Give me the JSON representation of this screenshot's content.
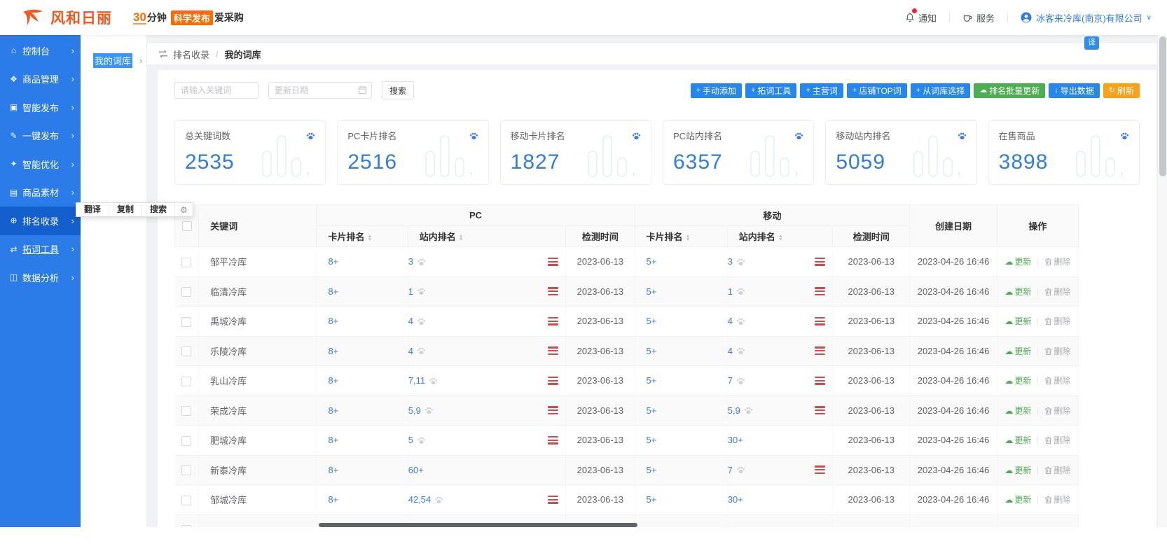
{
  "topbar": {
    "brand": "风和日丽",
    "tagline": {
      "num": "30",
      "unit": "分钟",
      "badge": "科学发布",
      "suffix": "爱采购"
    },
    "notify_label": "通知",
    "service_label": "服务",
    "account_label": "冰客来冷库(南京)有限公司"
  },
  "sidebar": {
    "items": [
      {
        "key": "dashboard",
        "icon": "home",
        "label": "控制台"
      },
      {
        "key": "product-management",
        "icon": "box",
        "label": "商品管理"
      },
      {
        "key": "smart-publish",
        "icon": "monitor",
        "label": "智能发布"
      },
      {
        "key": "one-click-publish",
        "icon": "pen",
        "label": "一键发布"
      },
      {
        "key": "smart-optimize",
        "icon": "magic",
        "label": "智能优化"
      },
      {
        "key": "product-materials",
        "icon": "image",
        "label": "商品素材"
      },
      {
        "key": "rank-index",
        "icon": "globe",
        "label": "排名收录",
        "active": true
      },
      {
        "key": "word-expand-tools",
        "icon": "code",
        "label": "拓词工具",
        "underline": true
      },
      {
        "key": "data-analytics",
        "icon": "chart",
        "label": "数据分析"
      }
    ]
  },
  "subsidebar": {
    "selected_item": "我的词库"
  },
  "selection_menu": {
    "items": [
      {
        "key": "translate",
        "label": "翻译"
      },
      {
        "key": "copy",
        "label": "复制"
      },
      {
        "key": "search",
        "label": "搜索"
      }
    ]
  },
  "breadcrumb": {
    "parent": "排名收录",
    "current": "我的词库"
  },
  "toolbar": {
    "keyword_placeholder": "请输入关键词",
    "date_placeholder": "更新日期",
    "search_label": "搜索",
    "buttons": [
      {
        "key": "manual-add",
        "icon": "plus",
        "style": "blue",
        "label": "手动添加"
      },
      {
        "key": "word-expand-tools",
        "icon": "plus",
        "style": "blue",
        "label": "拓词工具"
      },
      {
        "key": "main-words",
        "icon": "plus",
        "style": "blue",
        "label": "主营词"
      },
      {
        "key": "shop-top-words",
        "icon": "plus",
        "style": "blue",
        "label": "店铺TOP词"
      },
      {
        "key": "select-from-lexicon",
        "icon": "plus",
        "style": "blue",
        "label": "从词库选择"
      },
      {
        "key": "batch-update-rank",
        "icon": "cloud",
        "style": "green",
        "label": "排名批量更新"
      },
      {
        "key": "export-data",
        "icon": "download",
        "style": "blue",
        "label": "导出数据"
      },
      {
        "key": "refresh",
        "icon": "refresh",
        "style": "orange",
        "label": "刷新"
      }
    ]
  },
  "stats": [
    {
      "key": "total-keywords",
      "title": "总关键词数",
      "value": "2535"
    },
    {
      "key": "pc-card-rank",
      "title": "PC卡片排名",
      "value": "2516"
    },
    {
      "key": "mobile-card-rank",
      "title": "移动卡片排名",
      "value": "1827"
    },
    {
      "key": "pc-site-rank",
      "title": "PC站内排名",
      "value": "6357"
    },
    {
      "key": "mobile-site-rank",
      "title": "移动站内排名",
      "value": "5059"
    },
    {
      "key": "on-sale-products",
      "title": "在售商品",
      "value": "3898"
    }
  ],
  "table": {
    "headers": {
      "keyword": "关键词",
      "pc_group": "PC",
      "mobile_group": "移动",
      "card_rank": "卡片排名",
      "site_rank": "站内排名",
      "check_time": "检测时间",
      "created": "创建日期",
      "actions": "操作"
    },
    "action_labels": {
      "update": "更新",
      "delete": "删除"
    },
    "rows": [
      {
        "keyword": "邹平冷库",
        "pc_card": "8+",
        "pc_site": "3",
        "pc_paw": true,
        "pc_menu": true,
        "pc_time": "2023-06-13",
        "m_card": "5+",
        "m_site": "3",
        "m_paw": true,
        "m_menu": true,
        "m_time": "2023-06-13",
        "created": "2023-04-26 16:46"
      },
      {
        "keyword": "临清冷库",
        "pc_card": "8+",
        "pc_site": "1",
        "pc_paw": true,
        "pc_menu": true,
        "pc_time": "2023-06-13",
        "m_card": "5+",
        "m_site": "1",
        "m_paw": true,
        "m_menu": true,
        "m_time": "2023-06-13",
        "created": "2023-04-26 16:46"
      },
      {
        "keyword": "禹城冷库",
        "pc_card": "8+",
        "pc_site": "4",
        "pc_paw": true,
        "pc_menu": true,
        "pc_time": "2023-06-13",
        "m_card": "5+",
        "m_site": "4",
        "m_paw": true,
        "m_menu": true,
        "m_time": "2023-06-13",
        "created": "2023-04-26 16:46"
      },
      {
        "keyword": "乐陵冷库",
        "pc_card": "8+",
        "pc_site": "4",
        "pc_paw": true,
        "pc_menu": true,
        "pc_time": "2023-06-13",
        "m_card": "5+",
        "m_site": "4",
        "m_paw": true,
        "m_menu": true,
        "m_time": "2023-06-13",
        "created": "2023-04-26 16:46"
      },
      {
        "keyword": "乳山冷库",
        "pc_card": "8+",
        "pc_site": "7,11",
        "pc_paw": true,
        "pc_menu": true,
        "pc_time": "2023-06-13",
        "m_card": "5+",
        "m_site": "7",
        "m_paw": true,
        "m_menu": true,
        "m_time": "2023-06-13",
        "created": "2023-04-26 16:46"
      },
      {
        "keyword": "荣成冷库",
        "pc_card": "8+",
        "pc_site": "5,9",
        "pc_paw": true,
        "pc_menu": true,
        "pc_time": "2023-06-13",
        "m_card": "5+",
        "m_site": "5,9",
        "m_paw": true,
        "m_menu": true,
        "m_time": "2023-06-13",
        "created": "2023-04-26 16:46"
      },
      {
        "keyword": "肥城冷库",
        "pc_card": "8+",
        "pc_site": "5",
        "pc_paw": true,
        "pc_menu": true,
        "pc_time": "2023-06-13",
        "m_card": "5+",
        "m_site": "30+",
        "m_paw": false,
        "m_menu": false,
        "m_time": "2023-06-13",
        "created": "2023-04-26 16:46"
      },
      {
        "keyword": "新泰冷库",
        "pc_card": "8+",
        "pc_site": "60+",
        "pc_paw": false,
        "pc_menu": false,
        "pc_time": "2023-06-13",
        "m_card": "5+",
        "m_site": "7",
        "m_paw": true,
        "m_menu": true,
        "m_time": "2023-06-13",
        "created": "2023-04-26 16:46"
      },
      {
        "keyword": "邹城冷库",
        "pc_card": "8+",
        "pc_site": "42,54",
        "pc_paw": true,
        "pc_menu": true,
        "pc_time": "2023-06-13",
        "m_card": "5+",
        "m_site": "30+",
        "m_paw": false,
        "m_menu": false,
        "m_time": "2023-06-13",
        "created": "2023-04-26 16:46"
      }
    ]
  },
  "float_icon_glyph": "译",
  "colors": {
    "sidebar_blue": "#2b7ce9",
    "sidebar_active_blue": "#145fce",
    "primary_blue": "#2586ee",
    "link_blue": "#3a7be0",
    "stat_number_blue": "#2f7de1",
    "success_green": "#4cae50",
    "warning_orange": "#f9a11b",
    "brand_orange": "#f4581c",
    "badge_orange": "#ff6a00",
    "danger_red": "#cf4a4a"
  }
}
